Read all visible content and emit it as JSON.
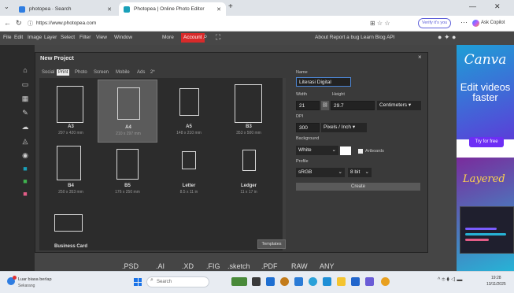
{
  "browser": {
    "tabs": [
      {
        "label": "photopea · Search",
        "icon": "search-favicon"
      },
      {
        "label": "Photopea | Online Photo Editor",
        "icon": "photopea-favicon"
      }
    ],
    "new_tab": "+",
    "url": "https://www.photopea.com",
    "verify_label": "Verify it's you",
    "copilot_label": "Ask Copilot",
    "window_min": "—",
    "window_close": "✕"
  },
  "menu": {
    "items": [
      "File",
      "Edit",
      "Image",
      "Layer",
      "Select",
      "Filter",
      "View",
      "Window",
      "More"
    ],
    "account": "Account",
    "right": "About  Report a bug  Learn  Blog  API"
  },
  "dialog": {
    "title": "New Project",
    "close": "×",
    "tabs": [
      "Social",
      "Print",
      "Photo",
      "Screen",
      "Mobile",
      "Ads",
      "2*"
    ],
    "active_tab": "Print",
    "templates": [
      {
        "name": "A3",
        "size": "297 x 420 mm"
      },
      {
        "name": "A4",
        "size": "210 x 297 mm",
        "selected": true
      },
      {
        "name": "A5",
        "size": "148 x 210 mm"
      },
      {
        "name": "B3",
        "size": "353 x 500 mm"
      },
      {
        "name": "B4",
        "size": "250 x 353 mm"
      },
      {
        "name": "B5",
        "size": "176 x 250 mm"
      },
      {
        "name": "Letter",
        "size": "8.5 x 11 in"
      },
      {
        "name": "Ledger",
        "size": "11 x 17 in"
      },
      {
        "name": "Business Card",
        "size": ""
      }
    ],
    "templates_button": "Templates",
    "form": {
      "name_label": "Name",
      "name_value": "Literasi Digital",
      "width_label": "Width",
      "height_label": "Height",
      "width_value": "21",
      "height_value": "29.7",
      "unit": "Centimeters ▾",
      "dpi_label": "DPI",
      "dpi_value": "300",
      "dpi_unit": "Pixels / Inch ▾",
      "background_label": "Background",
      "background_value": "White",
      "artboards_label": "Artboards",
      "profile_label": "Profile",
      "profile_value": "sRGB",
      "bit_value": "8 bit",
      "create_label": "Create"
    }
  },
  "export_formats": [
    ".PSD",
    ".AI",
    ".XD",
    ".FIG",
    ".sketch",
    ".PDF",
    "RAW",
    "ANY"
  ],
  "ad": {
    "logo": "Canva",
    "headline": "Edit videos faster",
    "cta": "Try for free",
    "tagline": "Layered"
  },
  "taskbar": {
    "weather_line1": "Luar biasa berlap",
    "weather_line2": "Sekarang",
    "search_placeholder": "Search",
    "clock_time": "19:28",
    "clock_date": "13/11/2025"
  }
}
